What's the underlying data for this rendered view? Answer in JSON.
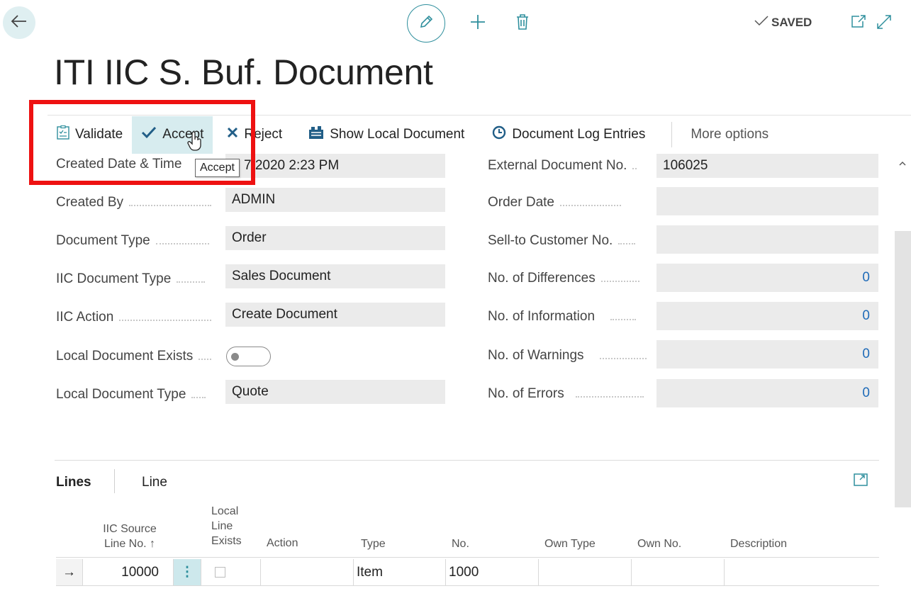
{
  "header": {
    "title": "ITI IIC S. Buf. Document",
    "saved_label": "SAVED"
  },
  "actions": {
    "validate": "Validate",
    "accept": "Accept",
    "reject": "Reject",
    "show_local_document": "Show Local Document",
    "document_log_entries": "Document Log Entries",
    "more_options": "More options"
  },
  "tooltip": "Accept",
  "general": {
    "created_date_time": {
      "label": "Created Date & Time",
      "value": "7/2020 2:23 PM"
    },
    "created_by": {
      "label": "Created By",
      "value": "ADMIN"
    },
    "document_type": {
      "label": "Document Type",
      "value": "Order"
    },
    "iic_document_type": {
      "label": "IIC Document Type",
      "value": "Sales Document"
    },
    "iic_action": {
      "label": "IIC Action",
      "value": "Create Document"
    },
    "local_document_exists": {
      "label": "Local Document Exists",
      "value": false
    },
    "local_document_type": {
      "label": "Local Document Type",
      "value": "Quote"
    },
    "external_document_no": {
      "label": "External Document No.",
      "value": "106025"
    },
    "order_date": {
      "label": "Order Date",
      "value": ""
    },
    "sell_to_customer_no": {
      "label": "Sell-to Customer No.",
      "value": ""
    },
    "no_of_differences": {
      "label": "No. of Differences",
      "value": "0"
    },
    "no_of_information": {
      "label": "No. of Information",
      "value": "0"
    },
    "no_of_warnings": {
      "label": "No. of Warnings",
      "value": "0"
    },
    "no_of_errors": {
      "label": "No. of Errors",
      "value": "0"
    }
  },
  "lines": {
    "tab_lines": "Lines",
    "tab_line": "Line",
    "columns": {
      "iic_source_line_no_1": "IIC Source",
      "iic_source_line_no_2": "Line No. ↑",
      "local_line_exists_1": "Local",
      "local_line_exists_2": "Line",
      "local_line_exists_3": "Exists",
      "action": "Action",
      "type": "Type",
      "no": "No.",
      "own_type": "Own Type",
      "own_no": "Own No.",
      "description": "Description"
    },
    "rows": [
      {
        "indicator": "→",
        "iic_source_line_no": "10000",
        "menu": "⋮",
        "local_line_exists": false,
        "action": "",
        "type": "Item",
        "no": "1000",
        "own_type": "",
        "own_no": "",
        "description": ""
      }
    ]
  },
  "colors": {
    "accent": "#2f8f9d",
    "highlight_box": "#ee1111",
    "active_action_bg": "#d7ecef",
    "field_bg": "#ebebeb",
    "number_link": "#1f6bb8"
  },
  "icons": [
    "back-arrow-icon",
    "pencil-icon",
    "plus-icon",
    "trash-icon",
    "checkmark-icon",
    "open-in-new-window-icon",
    "expand-icon",
    "validate-icon",
    "accept-check-icon",
    "reject-x-icon",
    "show-local-document-icon",
    "document-log-icon",
    "scroll-up-icon",
    "hand-cursor-icon",
    "expand-lines-icon",
    "row-menu-icon"
  ]
}
